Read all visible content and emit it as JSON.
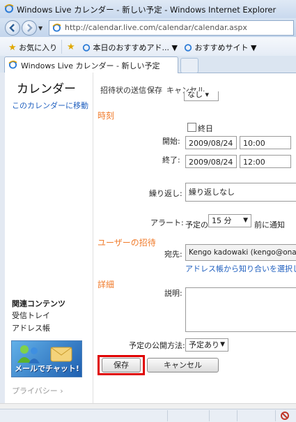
{
  "browser": {
    "window_title": "Windows Live カレンダー - 新しい予定 - Windows Internet Explorer",
    "address": "http://calendar.live.com/calendar/calendar.aspx",
    "favorites": {
      "label": "お気に入り",
      "item1": "本日のおすすめアド...",
      "item2": "おすすめサイト"
    },
    "tab_title": "Windows Live カレンダー - 新しい予定"
  },
  "sidebar": {
    "title": "カレンダー",
    "goto_link": "このカレンダーに移動",
    "related_header": "関連コンテンツ",
    "inbox": "受信トレイ",
    "address_book": "アドレス帳",
    "banner_text": "メールでチャット!",
    "privacy": "プライバシー"
  },
  "toolbar": {
    "send": "招待状の送信",
    "save": "保存",
    "cancel": "キャンセル"
  },
  "form": {
    "time_section": "時刻",
    "allday_label": "終日",
    "start_label": "開始:",
    "start_date": "2009/08/24",
    "start_time": "10:00",
    "end_label": "終了:",
    "end_date": "2009/08/24",
    "end_time": "12:00",
    "repeat_label": "繰り返し:",
    "repeat_value": "繰り返しなし",
    "alert_label": "アラート:",
    "alert_prefix": "予定の",
    "alert_value": "15 分",
    "alert_suffix": "前に通知",
    "invite_section": "ユーザーの招待",
    "to_label": "宛先:",
    "to_value": "Kengo kadowaki  (kengo@onair",
    "pick_link": "アドレス帳から知り合いを選択して",
    "details_section": "詳細",
    "desc_label": "説明:",
    "publish_label": "予定の公開方法:",
    "publish_value": "予定あり",
    "top_partial": "なし"
  },
  "buttons": {
    "save": "保存",
    "cancel": "キャンセル"
  },
  "colors": {
    "section": "#f07b2b",
    "link": "#1f5fbf",
    "highlight": "#e00000"
  }
}
